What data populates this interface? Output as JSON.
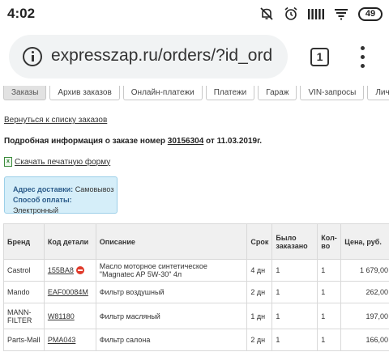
{
  "status_bar": {
    "time": "4:02",
    "battery": "49",
    "icons": [
      "mute-icon",
      "alarm-icon",
      "signal-icon",
      "wifi-icon",
      "battery-icon"
    ]
  },
  "browser": {
    "url": "expresszap.ru/orders/?id_ord",
    "tab_count": "1"
  },
  "nav": {
    "tabs": [
      "Заказы",
      "Архив заказов",
      "Онлайн-платежи",
      "Платежи",
      "Гараж",
      "VIN-запросы",
      "Личные данные"
    ]
  },
  "page": {
    "back_link": "Вернуться к списку заказов",
    "order_info_prefix": "Подробная информация о заказе номер",
    "order_number": "30156304",
    "order_info_suffix": "от 11.03.2019г.",
    "print_link": "Скачать печатную форму",
    "delivery_address_label": "Адрес доставки:",
    "delivery_address_value": "Самовывоз",
    "payment_label": "Способ оплаты:",
    "payment_value": "Электронный"
  },
  "table": {
    "headers": {
      "brand": "Бренд",
      "code": "Код детали",
      "description": "Описание",
      "term": "Срок",
      "ordered": "Было заказано",
      "qty": "Кол-во",
      "price": "Цена, руб."
    },
    "rows": [
      {
        "brand": "Castrol",
        "code": "155BA8",
        "description": "Масло моторное синтетическое \"Magnatec AP 5W-30\" 4л",
        "term": "4 дн",
        "ordered": "1",
        "qty": "1",
        "price": "1 679,00"
      },
      {
        "brand": "Mando",
        "code": "EAF00084M",
        "description": "Фильтр воздушный",
        "term": "2 дн",
        "ordered": "1",
        "qty": "1",
        "price": "262,00"
      },
      {
        "brand": "MANN-FILTER",
        "code": "W81180",
        "description": "Фильтр масляный",
        "term": "1 дн",
        "ordered": "1",
        "qty": "1",
        "price": "197,00"
      },
      {
        "brand": "Parts-Mall",
        "code": "PMA043",
        "description": "Фильтр салона",
        "term": "2 дн",
        "ordered": "1",
        "qty": "1",
        "price": "166,00"
      }
    ]
  }
}
